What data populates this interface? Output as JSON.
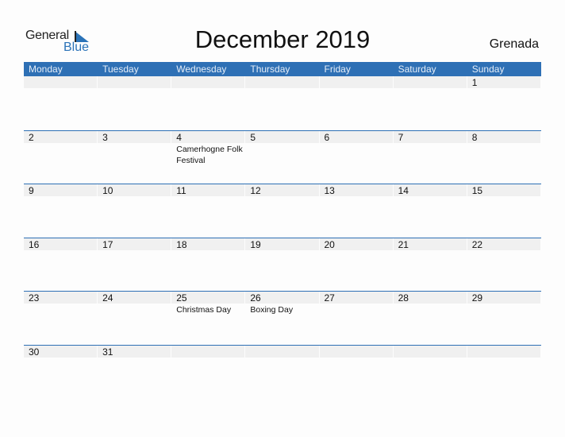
{
  "logo": {
    "word1": "General",
    "word2": "Blue",
    "icon": "triangle-flag-icon",
    "colors": {
      "text": "#222222",
      "accent": "#2b73b8"
    }
  },
  "title": "December 2019",
  "country": "Grenada",
  "colors": {
    "header_bg": "#2e70b5",
    "header_text": "#e6eef8",
    "day_band": "#f0f0f0",
    "row_rule": "#2e70b5"
  },
  "weekdays": [
    "Monday",
    "Tuesday",
    "Wednesday",
    "Thursday",
    "Friday",
    "Saturday",
    "Sunday"
  ],
  "weeks": [
    [
      {
        "day": ""
      },
      {
        "day": ""
      },
      {
        "day": ""
      },
      {
        "day": ""
      },
      {
        "day": ""
      },
      {
        "day": ""
      },
      {
        "day": "1"
      }
    ],
    [
      {
        "day": "2"
      },
      {
        "day": "3"
      },
      {
        "day": "4",
        "event": "Camerhogne Folk Festival"
      },
      {
        "day": "5"
      },
      {
        "day": "6"
      },
      {
        "day": "7"
      },
      {
        "day": "8"
      }
    ],
    [
      {
        "day": "9"
      },
      {
        "day": "10"
      },
      {
        "day": "11"
      },
      {
        "day": "12"
      },
      {
        "day": "13"
      },
      {
        "day": "14"
      },
      {
        "day": "15"
      }
    ],
    [
      {
        "day": "16"
      },
      {
        "day": "17"
      },
      {
        "day": "18"
      },
      {
        "day": "19"
      },
      {
        "day": "20"
      },
      {
        "day": "21"
      },
      {
        "day": "22"
      }
    ],
    [
      {
        "day": "23"
      },
      {
        "day": "24"
      },
      {
        "day": "25",
        "event": "Christmas Day"
      },
      {
        "day": "26",
        "event": "Boxing Day"
      },
      {
        "day": "27"
      },
      {
        "day": "28"
      },
      {
        "day": "29"
      }
    ],
    [
      {
        "day": "30"
      },
      {
        "day": "31"
      },
      {
        "day": ""
      },
      {
        "day": ""
      },
      {
        "day": ""
      },
      {
        "day": ""
      },
      {
        "day": ""
      }
    ]
  ]
}
